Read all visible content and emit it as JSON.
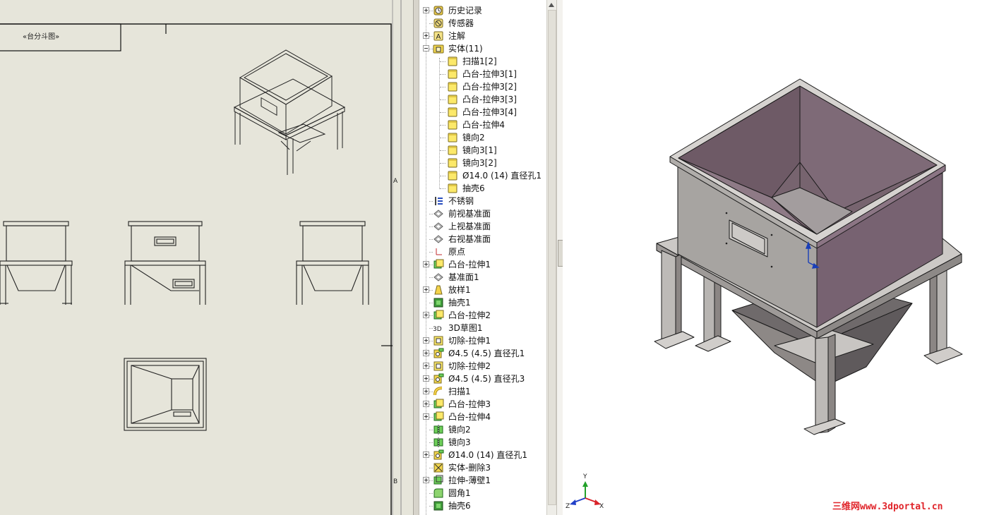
{
  "drawing": {
    "title_block_text": "«台分斗图»",
    "border_marks": [
      "A",
      "B"
    ]
  },
  "tree": {
    "items": [
      {
        "label": "历史记录",
        "icon": "history-icon",
        "expander": "plus",
        "level": 0
      },
      {
        "label": "传感器",
        "icon": "sensor-icon",
        "expander": "none",
        "level": 0
      },
      {
        "label": "注解",
        "icon": "annotation-icon",
        "expander": "plus",
        "level": 0
      },
      {
        "label": "实体(11)",
        "icon": "solid-bodies-folder-icon",
        "expander": "minus",
        "level": 0
      },
      {
        "label": "扫描1[2]",
        "icon": "solid-body-icon",
        "expander": "none",
        "level": 1
      },
      {
        "label": "凸台-拉伸3[1]",
        "icon": "solid-body-icon",
        "expander": "none",
        "level": 1
      },
      {
        "label": "凸台-拉伸3[2]",
        "icon": "solid-body-icon",
        "expander": "none",
        "level": 1
      },
      {
        "label": "凸台-拉伸3[3]",
        "icon": "solid-body-icon",
        "expander": "none",
        "level": 1
      },
      {
        "label": "凸台-拉伸3[4]",
        "icon": "solid-body-icon",
        "expander": "none",
        "level": 1
      },
      {
        "label": "凸台-拉伸4",
        "icon": "solid-body-icon",
        "expander": "none",
        "level": 1
      },
      {
        "label": "镜向2",
        "icon": "solid-body-icon",
        "expander": "none",
        "level": 1
      },
      {
        "label": "镜向3[1]",
        "icon": "solid-body-icon",
        "expander": "none",
        "level": 1
      },
      {
        "label": "镜向3[2]",
        "icon": "solid-body-icon",
        "expander": "none",
        "level": 1
      },
      {
        "label": "Ø14.0 (14) 直径孔1",
        "icon": "solid-body-icon",
        "expander": "none",
        "level": 1
      },
      {
        "label": "抽壳6",
        "icon": "solid-body-icon",
        "expander": "none",
        "level": 1
      },
      {
        "label": "不锈钢",
        "icon": "material-icon",
        "expander": "none",
        "level": 0
      },
      {
        "label": "前视基准面",
        "icon": "plane-icon",
        "expander": "none",
        "level": 0
      },
      {
        "label": "上视基准面",
        "icon": "plane-icon",
        "expander": "none",
        "level": 0
      },
      {
        "label": "右视基准面",
        "icon": "plane-icon",
        "expander": "none",
        "level": 0
      },
      {
        "label": "原点",
        "icon": "origin-icon",
        "expander": "none",
        "level": 0
      },
      {
        "label": "凸台-拉伸1",
        "icon": "extrude-boss-icon",
        "expander": "plus",
        "level": 0
      },
      {
        "label": "基准面1",
        "icon": "plane-icon",
        "expander": "none",
        "level": 0
      },
      {
        "label": "放样1",
        "icon": "loft-icon",
        "expander": "plus",
        "level": 0
      },
      {
        "label": "抽壳1",
        "icon": "shell-icon",
        "expander": "none",
        "level": 0
      },
      {
        "label": "凸台-拉伸2",
        "icon": "extrude-boss-icon",
        "expander": "plus",
        "level": 0
      },
      {
        "label": "3D草图1",
        "icon": "sketch-3d-icon",
        "expander": "none",
        "level": 0
      },
      {
        "label": "切除-拉伸1",
        "icon": "extrude-cut-icon",
        "expander": "plus",
        "level": 0
      },
      {
        "label": "Ø4.5 (4.5) 直径孔1",
        "icon": "hole-wizard-icon",
        "expander": "plus",
        "level": 0
      },
      {
        "label": "切除-拉伸2",
        "icon": "extrude-cut-icon",
        "expander": "plus",
        "level": 0
      },
      {
        "label": "Ø4.5 (4.5) 直径孔3",
        "icon": "hole-wizard-icon",
        "expander": "plus",
        "level": 0
      },
      {
        "label": "扫描1",
        "icon": "sweep-icon",
        "expander": "plus",
        "level": 0
      },
      {
        "label": "凸台-拉伸3",
        "icon": "extrude-boss-icon",
        "expander": "plus",
        "level": 0
      },
      {
        "label": "凸台-拉伸4",
        "icon": "extrude-boss-icon",
        "expander": "plus",
        "level": 0
      },
      {
        "label": "镜向2",
        "icon": "mirror-icon",
        "expander": "none",
        "level": 0
      },
      {
        "label": "镜向3",
        "icon": "mirror-icon",
        "expander": "none",
        "level": 0
      },
      {
        "label": "Ø14.0 (14) 直径孔1",
        "icon": "hole-wizard-icon",
        "expander": "plus",
        "level": 0
      },
      {
        "label": "实体-删除3",
        "icon": "delete-body-icon",
        "expander": "none",
        "level": 0
      },
      {
        "label": "拉伸-薄壁1",
        "icon": "thin-extrude-icon",
        "expander": "plus",
        "level": 0
      },
      {
        "label": "圆角1",
        "icon": "fillet-icon",
        "expander": "none",
        "level": 0
      },
      {
        "label": "抽壳6",
        "icon": "shell-icon",
        "expander": "none",
        "level": 0
      }
    ]
  },
  "viewport": {
    "triad_labels": {
      "x": "X",
      "y": "Y",
      "z": "Z"
    },
    "watermark": "三维网www.3dportal.cn"
  },
  "colors": {
    "drawing_bg": "#e6e5da",
    "model_face_light": "#a9a6a3",
    "model_face_dark": "#7b6470",
    "watermark": "#e0242a"
  }
}
